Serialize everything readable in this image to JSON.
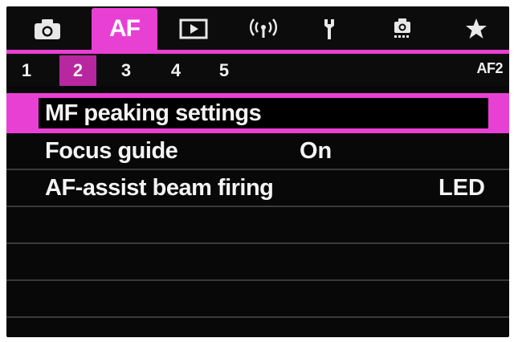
{
  "tabs": [
    {
      "icon": "camera-icon"
    },
    {
      "label": "AF",
      "active": true
    },
    {
      "icon": "playback-icon"
    },
    {
      "icon": "wireless-icon"
    },
    {
      "icon": "wrench-icon"
    },
    {
      "icon": "custom-camera-icon"
    },
    {
      "icon": "star-icon"
    }
  ],
  "subtabs": [
    "1",
    "2",
    "3",
    "4",
    "5"
  ],
  "active_subtab": "2",
  "page_code": "AF2",
  "menu_items": [
    {
      "label": "MF peaking settings",
      "value": ""
    },
    {
      "label": "Focus guide",
      "value": "On"
    },
    {
      "label": "AF-assist beam firing",
      "value": "LED"
    }
  ],
  "colors": {
    "accent": "#e940d4",
    "subtab_active": "#b8279f",
    "background": "#080808",
    "text": "#f4f4f4"
  }
}
